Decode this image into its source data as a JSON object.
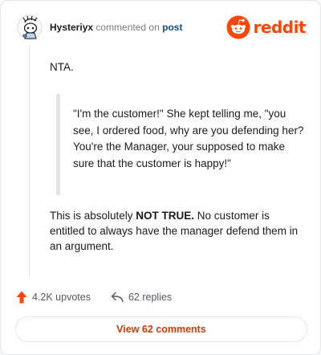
{
  "header": {
    "username": "Hysteriyx",
    "action_text": "commented on",
    "post_link": "post",
    "brand_name": "reddit"
  },
  "comment": {
    "paragraph_1": "NTA.",
    "quote": "\"I'm the customer!\" She kept telling me, \"you see, I ordered food, why are you defending her? You're the Manager, your supposed to make sure that the customer is happy!\"",
    "paragraph_2_before": "This is absolutely ",
    "paragraph_2_bold": "NOT TRUE.",
    "paragraph_2_after": " No customer is entitled to always have the manager defend them in an argument."
  },
  "actions": {
    "upvotes": "4.2K upvotes",
    "replies": "62 replies"
  },
  "footer": {
    "view_comments": "View 62 comments"
  },
  "colors": {
    "brand": "#ff4500",
    "link": "#0b4f8a",
    "button_text": "#d93a00"
  },
  "icons": {
    "avatar": "snoo-avatar",
    "brand": "reddit-logo-icon",
    "upvote": "upvote-arrow-icon",
    "reply": "reply-arrow-icon"
  }
}
